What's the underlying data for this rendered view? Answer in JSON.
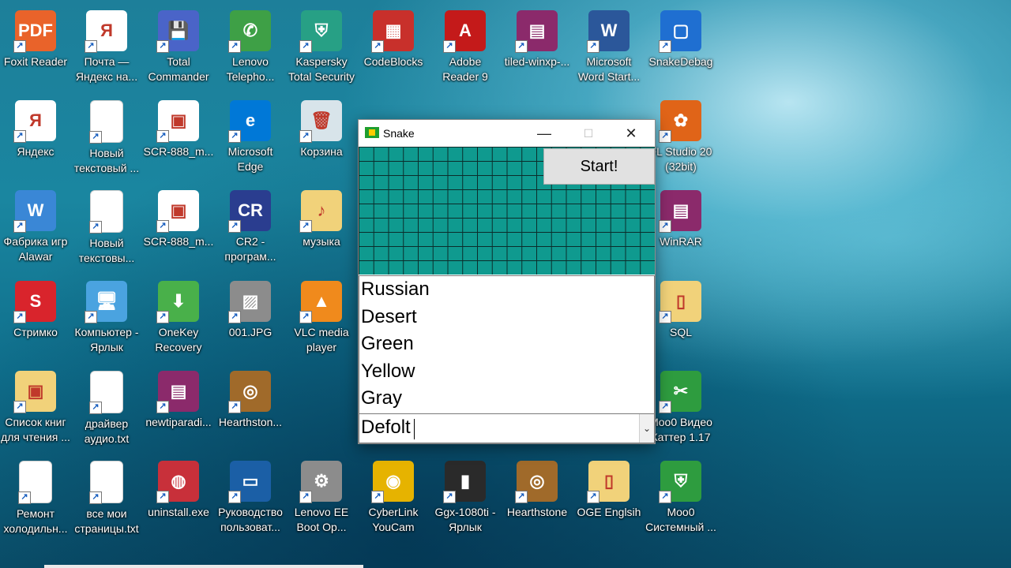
{
  "desktop": {
    "icons": [
      {
        "label": "Foxit Reader",
        "color": "#e9632a",
        "glyph": "PDF",
        "icon": "foxit-reader-icon"
      },
      {
        "label": "Почта —\nЯндекс на...",
        "color": "#ffffff",
        "glyph": "Я",
        "icon": "mail-yandex-icon"
      },
      {
        "label": "Total\nCommander",
        "color": "#4a64c8",
        "glyph": "💾",
        "icon": "total-commander-icon"
      },
      {
        "label": "Lenovo\nTelepho...",
        "color": "#3ea046",
        "glyph": "✆",
        "icon": "lenovo-telephony-icon"
      },
      {
        "label": "Kaspersky\nTotal Security",
        "color": "#27a085",
        "glyph": "⛨",
        "icon": "kaspersky-icon"
      },
      {
        "label": "CodeBlocks",
        "color": "#c8302b",
        "glyph": "▦",
        "icon": "codeblocks-icon"
      },
      {
        "label": "Adobe\nReader 9",
        "color": "#c41a1a",
        "glyph": "A",
        "icon": "adobe-reader-icon"
      },
      {
        "label": "tiled-winxp-...",
        "color": "#8b2a6b",
        "glyph": "▤",
        "icon": "winrar-archive-icon"
      },
      {
        "label": "Microsoft\nWord Start...",
        "color": "#2b579a",
        "glyph": "W",
        "icon": "word-icon"
      },
      {
        "label": "SnakeDebag",
        "color": "#1f6fd1",
        "glyph": "▢",
        "icon": "snake-debug-icon"
      },
      {
        "label": "Яндекс",
        "color": "#ffffff",
        "glyph": "Я",
        "icon": "yandex-icon"
      },
      {
        "label": "Новый\nтекстовый ...",
        "color": "#ffffff",
        "glyph": "",
        "icon": "text-file-icon"
      },
      {
        "label": "SCR-888_m...",
        "color": "#ffffff",
        "glyph": "▣",
        "icon": "image-file-icon"
      },
      {
        "label": "Microsoft\nEdge",
        "color": "#0078d7",
        "glyph": "e",
        "icon": "edge-icon"
      },
      {
        "label": "Корзина",
        "color": "#d8e4ea",
        "glyph": "🗑",
        "icon": "recycle-bin-icon"
      },
      {
        "label": "FL Studio 20\n(32bit)",
        "color": "#e06418",
        "glyph": "✿",
        "icon": "fl-studio-icon"
      },
      {
        "label": "Фабрика игр\nAlawar",
        "color": "#3a87d6",
        "glyph": "W",
        "icon": "alawar-icon"
      },
      {
        "label": "Новый\nтекстовы...",
        "color": "#ffffff",
        "glyph": "",
        "icon": "text-file-icon"
      },
      {
        "label": "SCR-888_m...",
        "color": "#ffffff",
        "glyph": "▣",
        "icon": "image-file-icon"
      },
      {
        "label": "CR2 -\nпрограм...",
        "color": "#2a3d8f",
        "glyph": "CR",
        "icon": "cr2-icon"
      },
      {
        "label": "музыка",
        "color": "#f1d27a",
        "glyph": "♪",
        "icon": "music-folder-icon"
      },
      {
        "label": "WinRAR",
        "color": "#8b2a6b",
        "glyph": "▤",
        "icon": "winrar-icon"
      },
      {
        "label": "Стримко",
        "color": "#d9242c",
        "glyph": "S",
        "icon": "strimko-icon"
      },
      {
        "label": "Компьютер -\nЯрлык",
        "color": "#4aa3e0",
        "glyph": "🖥",
        "icon": "computer-icon"
      },
      {
        "label": "OneKey\nRecovery",
        "color": "#49b04a",
        "glyph": "⬇",
        "icon": "onekey-recovery-icon"
      },
      {
        "label": "001.JPG",
        "color": "#8c8c8c",
        "glyph": "▨",
        "icon": "jpg-file-icon"
      },
      {
        "label": "VLC media\nplayer",
        "color": "#f08a1c",
        "glyph": "▲",
        "icon": "vlc-icon"
      },
      {
        "label": "SQL",
        "color": "#f1d27a",
        "glyph": "▯",
        "icon": "sql-folder-icon"
      },
      {
        "label": "Список книг\nдля чтения ...",
        "color": "#f1d27a",
        "glyph": "▣",
        "icon": "books-list-icon"
      },
      {
        "label": "драйвер\nаудио.txt",
        "color": "#ffffff",
        "glyph": "",
        "icon": "text-file-icon"
      },
      {
        "label": "newtiparadi...",
        "color": "#8b2a6b",
        "glyph": "▤",
        "icon": "winrar-archive-icon"
      },
      {
        "label": "Hearthston...",
        "color": "#a06a2a",
        "glyph": "◎",
        "icon": "hearthstone-icon"
      },
      {
        "label": "Moo0 Видео\nКаттер 1.17",
        "color": "#2e9c3f",
        "glyph": "✂",
        "icon": "moo0-video-cutter-icon"
      },
      {
        "label": "Ремонт\nхолодильн...",
        "color": "#ffffff",
        "glyph": "",
        "icon": "text-file-icon"
      },
      {
        "label": "все мои\nстраницы.txt",
        "color": "#ffffff",
        "glyph": "",
        "icon": "text-file-icon"
      },
      {
        "label": "uninstall.exe",
        "color": "#c8303a",
        "glyph": "◍",
        "icon": "uninstall-icon"
      },
      {
        "label": "Руководство\nпользоват...",
        "color": "#1b5fa6",
        "glyph": "▭",
        "icon": "lenovo-guide-icon"
      },
      {
        "label": "Lenovo EE\nBoot Op...",
        "color": "#8c8c8c",
        "glyph": "⚙",
        "icon": "lenovo-boot-icon"
      },
      {
        "label": "CyberLink\nYouCam",
        "color": "#e6b300",
        "glyph": "◉",
        "icon": "youcam-icon"
      },
      {
        "label": "Ggx-1080ti -\nЯрлык",
        "color": "#2a2a2a",
        "glyph": "▮",
        "icon": "ggx-shortcut-icon"
      },
      {
        "label": "Hearthstone",
        "color": "#a06a2a",
        "glyph": "◎",
        "icon": "hearthstone-icon"
      },
      {
        "label": "OGE Englsih",
        "color": "#f1d27a",
        "glyph": "▯",
        "icon": "oge-folder-icon"
      },
      {
        "label": "Moo0\nСистемный ...",
        "color": "#2e9c3f",
        "glyph": "⛨",
        "icon": "moo0-system-icon"
      }
    ]
  },
  "window": {
    "title": "Snake",
    "minimize": "—",
    "maximize": "☐",
    "close": "✕",
    "start_label": "Start!",
    "list_items": [
      "Russian",
      "Desert",
      "Green",
      "Yellow",
      "Gray"
    ],
    "combo_value": "Defolt",
    "combo_arrow": "⌄"
  }
}
